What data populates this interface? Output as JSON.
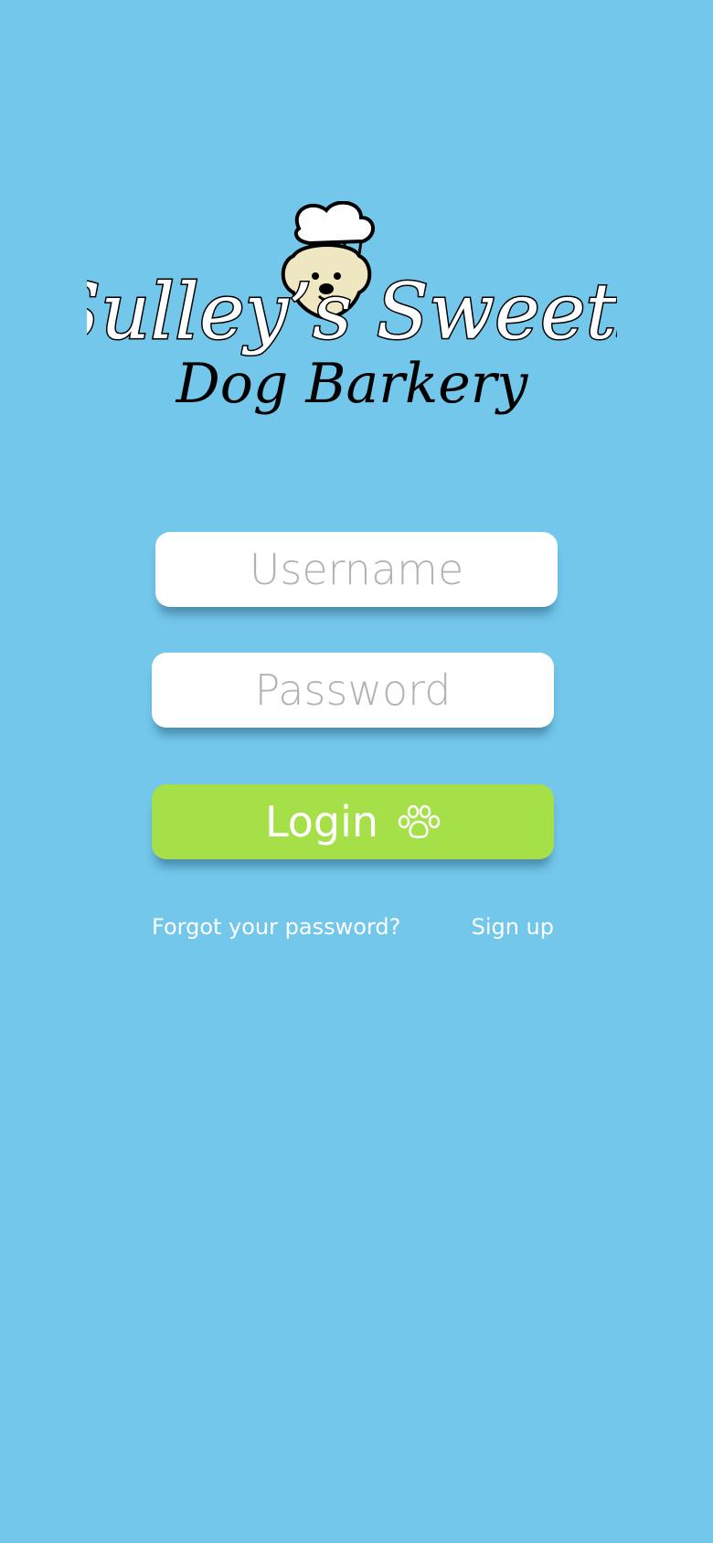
{
  "brand": {
    "name": "Sulley's Sweets",
    "tagline": "Dog Barkery"
  },
  "login_form": {
    "username_placeholder": "Username",
    "password_placeholder": "Password",
    "login_label": "Login",
    "login_icon": "paw-icon"
  },
  "links": {
    "forgot_password": "Forgot your password?",
    "sign_up": "Sign up"
  },
  "colors": {
    "background": "#72c7eb",
    "login_button": "#a5e048",
    "field_background": "#ffffff",
    "placeholder_text": "#b3b3b3"
  }
}
